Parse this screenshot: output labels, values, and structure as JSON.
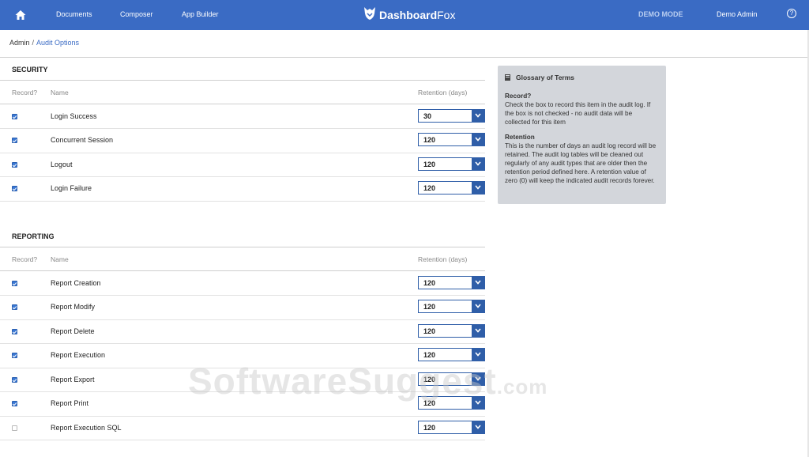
{
  "nav": {
    "items": [
      {
        "label": "Documents"
      },
      {
        "label": "Composer"
      },
      {
        "label": "App Builder"
      }
    ],
    "brand_bold": "Dashboard",
    "brand_light": "Fox",
    "mode": "DEMO MODE",
    "user": "Demo Admin",
    "help_glyph": "?"
  },
  "breadcrumb": {
    "root": "Admin",
    "sep": "/",
    "current": "Audit Options"
  },
  "columns": {
    "record": "Record?",
    "name": "Name",
    "retention": "Retention (days)"
  },
  "security": {
    "title": "SECURITY",
    "rows": [
      {
        "name": "Login Success",
        "checked": true,
        "retention": "30"
      },
      {
        "name": "Concurrent Session",
        "checked": true,
        "retention": "120"
      },
      {
        "name": "Logout",
        "checked": true,
        "retention": "120"
      },
      {
        "name": "Login Failure",
        "checked": true,
        "retention": "120"
      }
    ]
  },
  "reporting": {
    "title": "REPORTING",
    "rows": [
      {
        "name": "Report Creation",
        "checked": true,
        "retention": "120"
      },
      {
        "name": "Report Modify",
        "checked": true,
        "retention": "120"
      },
      {
        "name": "Report Delete",
        "checked": true,
        "retention": "120"
      },
      {
        "name": "Report Execution",
        "checked": true,
        "retention": "120"
      },
      {
        "name": "Report Export",
        "checked": true,
        "retention": "120"
      },
      {
        "name": "Report Print",
        "checked": true,
        "retention": "120"
      },
      {
        "name": "Report Execution SQL",
        "checked": false,
        "retention": "120"
      }
    ]
  },
  "glossary": {
    "title": "Glossary of Terms",
    "terms": [
      {
        "term": "Record?",
        "definition": "Check the box to record this item in the audit log. If the box is not checked - no audit data will be collected for this item"
      },
      {
        "term": "Retention",
        "definition": "This is the number of days an audit log record will be retained. The audit log tables will be cleaned out regularly of any audit types that are older then the retention period defined here. A retention value of zero (0) will keep the indicated audit records forever."
      }
    ]
  },
  "watermark": {
    "main": "SoftwareSuggest",
    "suffix": ".com"
  },
  "colors": {
    "topbar": "#3a6bc4",
    "accent": "#2f5ea8",
    "glossary_bg": "#d3d6db"
  },
  "icons": {
    "home": "home-icon",
    "logo": "fox-logo-icon",
    "help": "help-circle-icon",
    "book": "book-icon",
    "dropdown": "chevron-down-icon"
  }
}
